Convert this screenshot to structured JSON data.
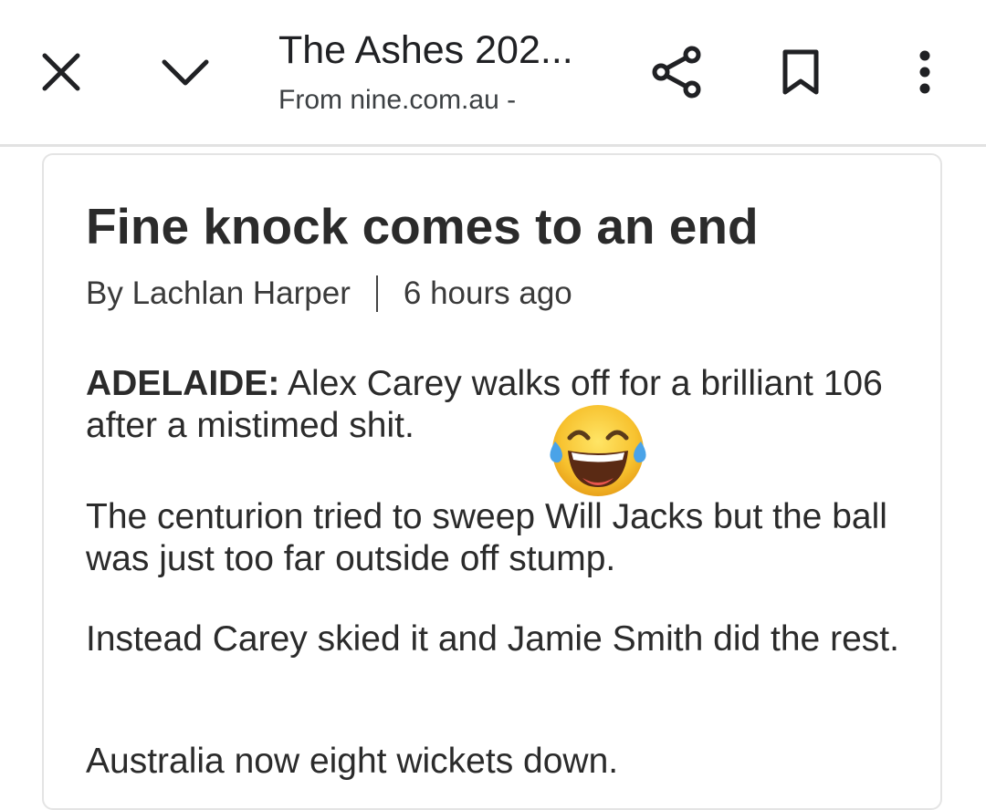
{
  "header": {
    "tab_title": "The Ashes 202...",
    "source": "From nine.com.au -",
    "icons": [
      "close-icon",
      "chevron-down-icon",
      "share-icon",
      "bookmark-icon",
      "more-vert-icon"
    ]
  },
  "article": {
    "headline": "Fine knock comes to an end",
    "author": "By Lachlan Harper",
    "time": "6 hours ago",
    "dateline": "ADELAIDE:",
    "p1_text": " Alex Carey walks off for a brilliant 106 after a mistimed shit.",
    "p2": "The centurion tried to sweep Will Jacks but the ball was just too far outside off stump.",
    "p3": "Instead Carey skied it and Jamie Smith did the rest.",
    "p4": "Australia now eight wickets down.",
    "emoji": "face-with-tears-of-joy"
  },
  "colors": {
    "text": "#2b2b2b",
    "divider": "#e2e2e2",
    "card_border": "#e4e4e4",
    "emoji_face": "#f7c22f"
  }
}
